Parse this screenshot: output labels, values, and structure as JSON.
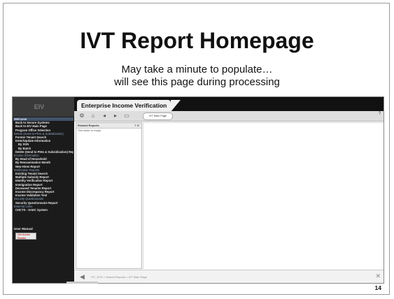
{
  "slide": {
    "title": "IVT Report Homepage",
    "subtitle_line1": "May take a minute to populate…",
    "subtitle_line2": "will see this page during processing",
    "page_number": "14"
  },
  "app": {
    "logo": "EIV",
    "title": "Enterprise Income Verification",
    "main_tab": "IVT Main Page",
    "help": "?",
    "toolbar_icons": [
      "gear-icon",
      "home-icon",
      "back-icon",
      "forward-icon",
      "folder-icon"
    ],
    "panel": {
      "title": "Related Reports",
      "controls": "? ✕",
      "empty_text": "This folder is empty."
    },
    "breadcrumbs": "IVT_SYS  >  Shared Reports  >  IVT Main Page",
    "manual_label": "User Manual",
    "adobe_label": "Get Adobe Reader"
  },
  "sidebar": {
    "items": [
      {
        "label": "Welcome",
        "kind": "header"
      },
      {
        "label": "Back to Secure Systems",
        "kind": "link"
      },
      {
        "label": "Back to EIV Main Page",
        "kind": "link"
      },
      {
        "label": "Program Office Selection",
        "kind": "link"
      },
      {
        "label": "Delete (Send to PIHs & Subsidization)",
        "kind": "section"
      },
      {
        "label": "Former Tenant Search",
        "kind": "link"
      },
      {
        "label": "Enter/Update Information",
        "kind": "link"
      },
      {
        "label": "By SSN",
        "kind": "sub"
      },
      {
        "label": "By Batch",
        "kind": "sub"
      },
      {
        "label": "Delete (Send to PIHs & Subsidization) Report",
        "kind": "link"
      },
      {
        "label": "Income Information",
        "kind": "section"
      },
      {
        "label": "By Head of Household",
        "kind": "link"
      },
      {
        "label": "By Reexamination Month",
        "kind": "link"
      },
      {
        "label": "New Hires Report",
        "kind": "link"
      },
      {
        "label": "Verification Reports",
        "kind": "section"
      },
      {
        "label": "Existing Tenant Search",
        "kind": "link"
      },
      {
        "label": "Multiple Subsidy Report",
        "kind": "link"
      },
      {
        "label": "Identity Verification Report",
        "kind": "link"
      },
      {
        "label": "Immigration Report",
        "kind": "link"
      },
      {
        "label": "Deceased Tenants Report",
        "kind": "link"
      },
      {
        "label": "Income Discrepancy Report",
        "kind": "link"
      },
      {
        "label": "Income Validation Tool",
        "kind": "link"
      },
      {
        "label": "Security Questionnaire",
        "kind": "section"
      },
      {
        "label": "Security Questionnaire Report",
        "kind": "link"
      },
      {
        "label": "External Links",
        "kind": "section"
      },
      {
        "label": "CHCTS - SAEC System",
        "kind": "link"
      }
    ]
  }
}
